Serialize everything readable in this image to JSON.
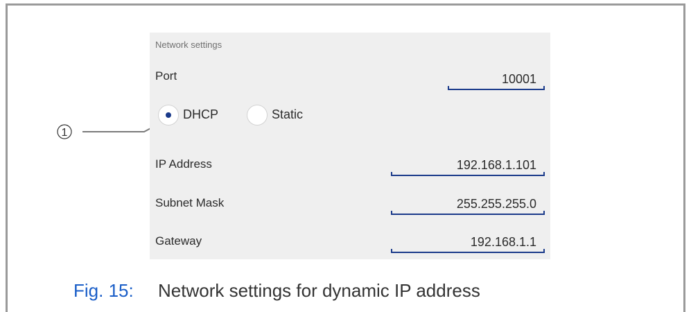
{
  "panel": {
    "title": "Network settings",
    "port_label": "Port",
    "port_value": "10001",
    "mode_options": [
      {
        "label": "DHCP",
        "selected": true
      },
      {
        "label": "Static",
        "selected": false
      }
    ],
    "ip_label": "IP Address",
    "ip_value": "192.168.1.101",
    "subnet_label": "Subnet Mask",
    "subnet_value": "255.255.255.0",
    "gateway_label": "Gateway",
    "gateway_value": "192.168.1.1"
  },
  "callout": {
    "marker": "①"
  },
  "caption": {
    "number": "Fig. 15:",
    "text": "Network settings for dynamic IP address"
  },
  "colors": {
    "accent": "#1a3a8a",
    "caption_number": "#1a5ec8",
    "panel_bg": "#efefef"
  }
}
